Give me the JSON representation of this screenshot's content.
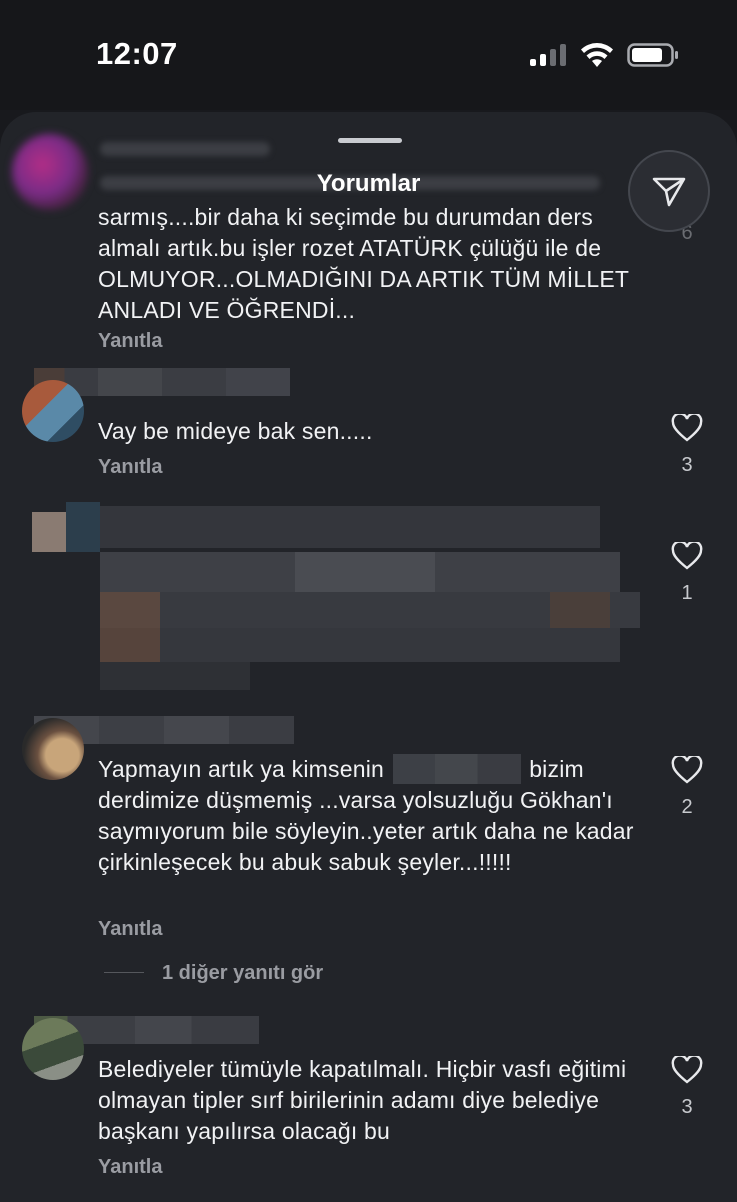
{
  "status_bar": {
    "time": "12:07"
  },
  "sheet": {
    "title": "Yorumlar"
  },
  "comments": [
    {
      "text": "sarmış....bir daha ki seçimde bu durumdan ders almalı artık.bu işler rozet ATATÜRK çülüğü ile de OLMUYOR...OLMADIĞINI DA ARTIK TÜM MİLLET ANLADI VE ÖĞRENDİ...",
      "reply_label": "Yanıtla",
      "likes": "6"
    },
    {
      "text": "Vay be mideye bak sen.....",
      "reply_label": "Yanıtla",
      "likes": "3"
    },
    {
      "text": "",
      "likes": "1"
    },
    {
      "text_before": "Yapmayın artık ya kimsenin",
      "text_after": "bizim derdimize düşmemiş ...varsa yolsuzluğu Gökhan'ı saymıyorum bile söyleyin..yeter artık daha ne kadar çirkinleşecek bu abuk sabuk şeyler...!!!!!",
      "reply_label": "Yanıtla",
      "more_replies": "1 diğer yanıtı gör",
      "likes": "2"
    },
    {
      "text": "Belediyeler tümüyle kapatılmalı. Hiçbir vasfı eğitimi olmayan tipler sırf birilerinin adamı diye belediye başkanı yapılırsa olacağı bu",
      "reply_label": "Yanıtla",
      "likes": "3"
    }
  ]
}
